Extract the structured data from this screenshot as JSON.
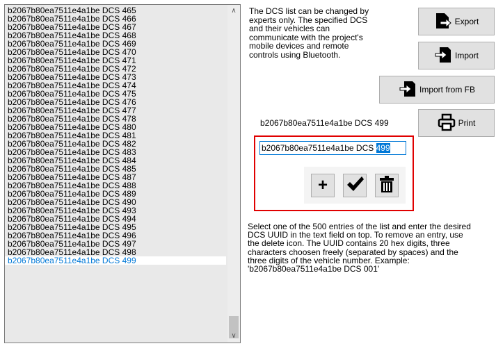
{
  "list": {
    "items": [
      "b2067b80ea7511e4a1be DCS 465",
      "b2067b80ea7511e4a1be DCS 466",
      "b2067b80ea7511e4a1be DCS 467",
      "b2067b80ea7511e4a1be DCS 468",
      "b2067b80ea7511e4a1be DCS 469",
      "b2067b80ea7511e4a1be DCS 470",
      "b2067b80ea7511e4a1be DCS 471",
      "b2067b80ea7511e4a1be DCS 472",
      "b2067b80ea7511e4a1be DCS 473",
      "b2067b80ea7511e4a1be DCS 474",
      "b2067b80ea7511e4a1be DCS 475",
      "b2067b80ea7511e4a1be DCS 476",
      "b2067b80ea7511e4a1be DCS 477",
      "b2067b80ea7511e4a1be DCS 478",
      "b2067b80ea7511e4a1be DCS 480",
      "b2067b80ea7511e4a1be DCS 481",
      "b2067b80ea7511e4a1be DCS 482",
      "b2067b80ea7511e4a1be DCS 483",
      "b2067b80ea7511e4a1be DCS 484",
      "b2067b80ea7511e4a1be DCS 485",
      "b2067b80ea7511e4a1be DCS 487",
      "b2067b80ea7511e4a1be DCS 488",
      "b2067b80ea7511e4a1be DCS 489",
      "b2067b80ea7511e4a1be DCS 490",
      "b2067b80ea7511e4a1be DCS 493",
      "b2067b80ea7511e4a1be DCS 494",
      "b2067b80ea7511e4a1be DCS 495",
      "b2067b80ea7511e4a1be DCS 496",
      "b2067b80ea7511e4a1be DCS 497",
      "b2067b80ea7511e4a1be DCS 498",
      "b2067b80ea7511e4a1be DCS 499"
    ],
    "selected_index": 30
  },
  "info_text": "The DCS list can be changed by experts only. The specified DCS and their vehicles can communicate with the project's mobile devices and remote controls using Bluetooth.",
  "buttons": {
    "export": "Export",
    "import": "Import",
    "import_fb": "Import from FB",
    "print": "Print"
  },
  "current_label": "b2067b80ea7511e4a1be DCS 499",
  "input": {
    "prefix": "b2067b80ea7511e4a1be DCS ",
    "selected": "499"
  },
  "actions": {
    "add": "+"
  },
  "help_text": "Select one of the 500 entries of the list and enter the desired DCS UUID in the text field on top. To remove an entry, use the delete icon. The UUID contains 20 hex digits, three characters choosen freely (separated by spaces) and the three digits of the vehicle number. Example: 'b2067b80ea7511e4a1be DCS 001'",
  "colors": {
    "highlight_border": "#e00000",
    "selection": "#0078d7"
  }
}
